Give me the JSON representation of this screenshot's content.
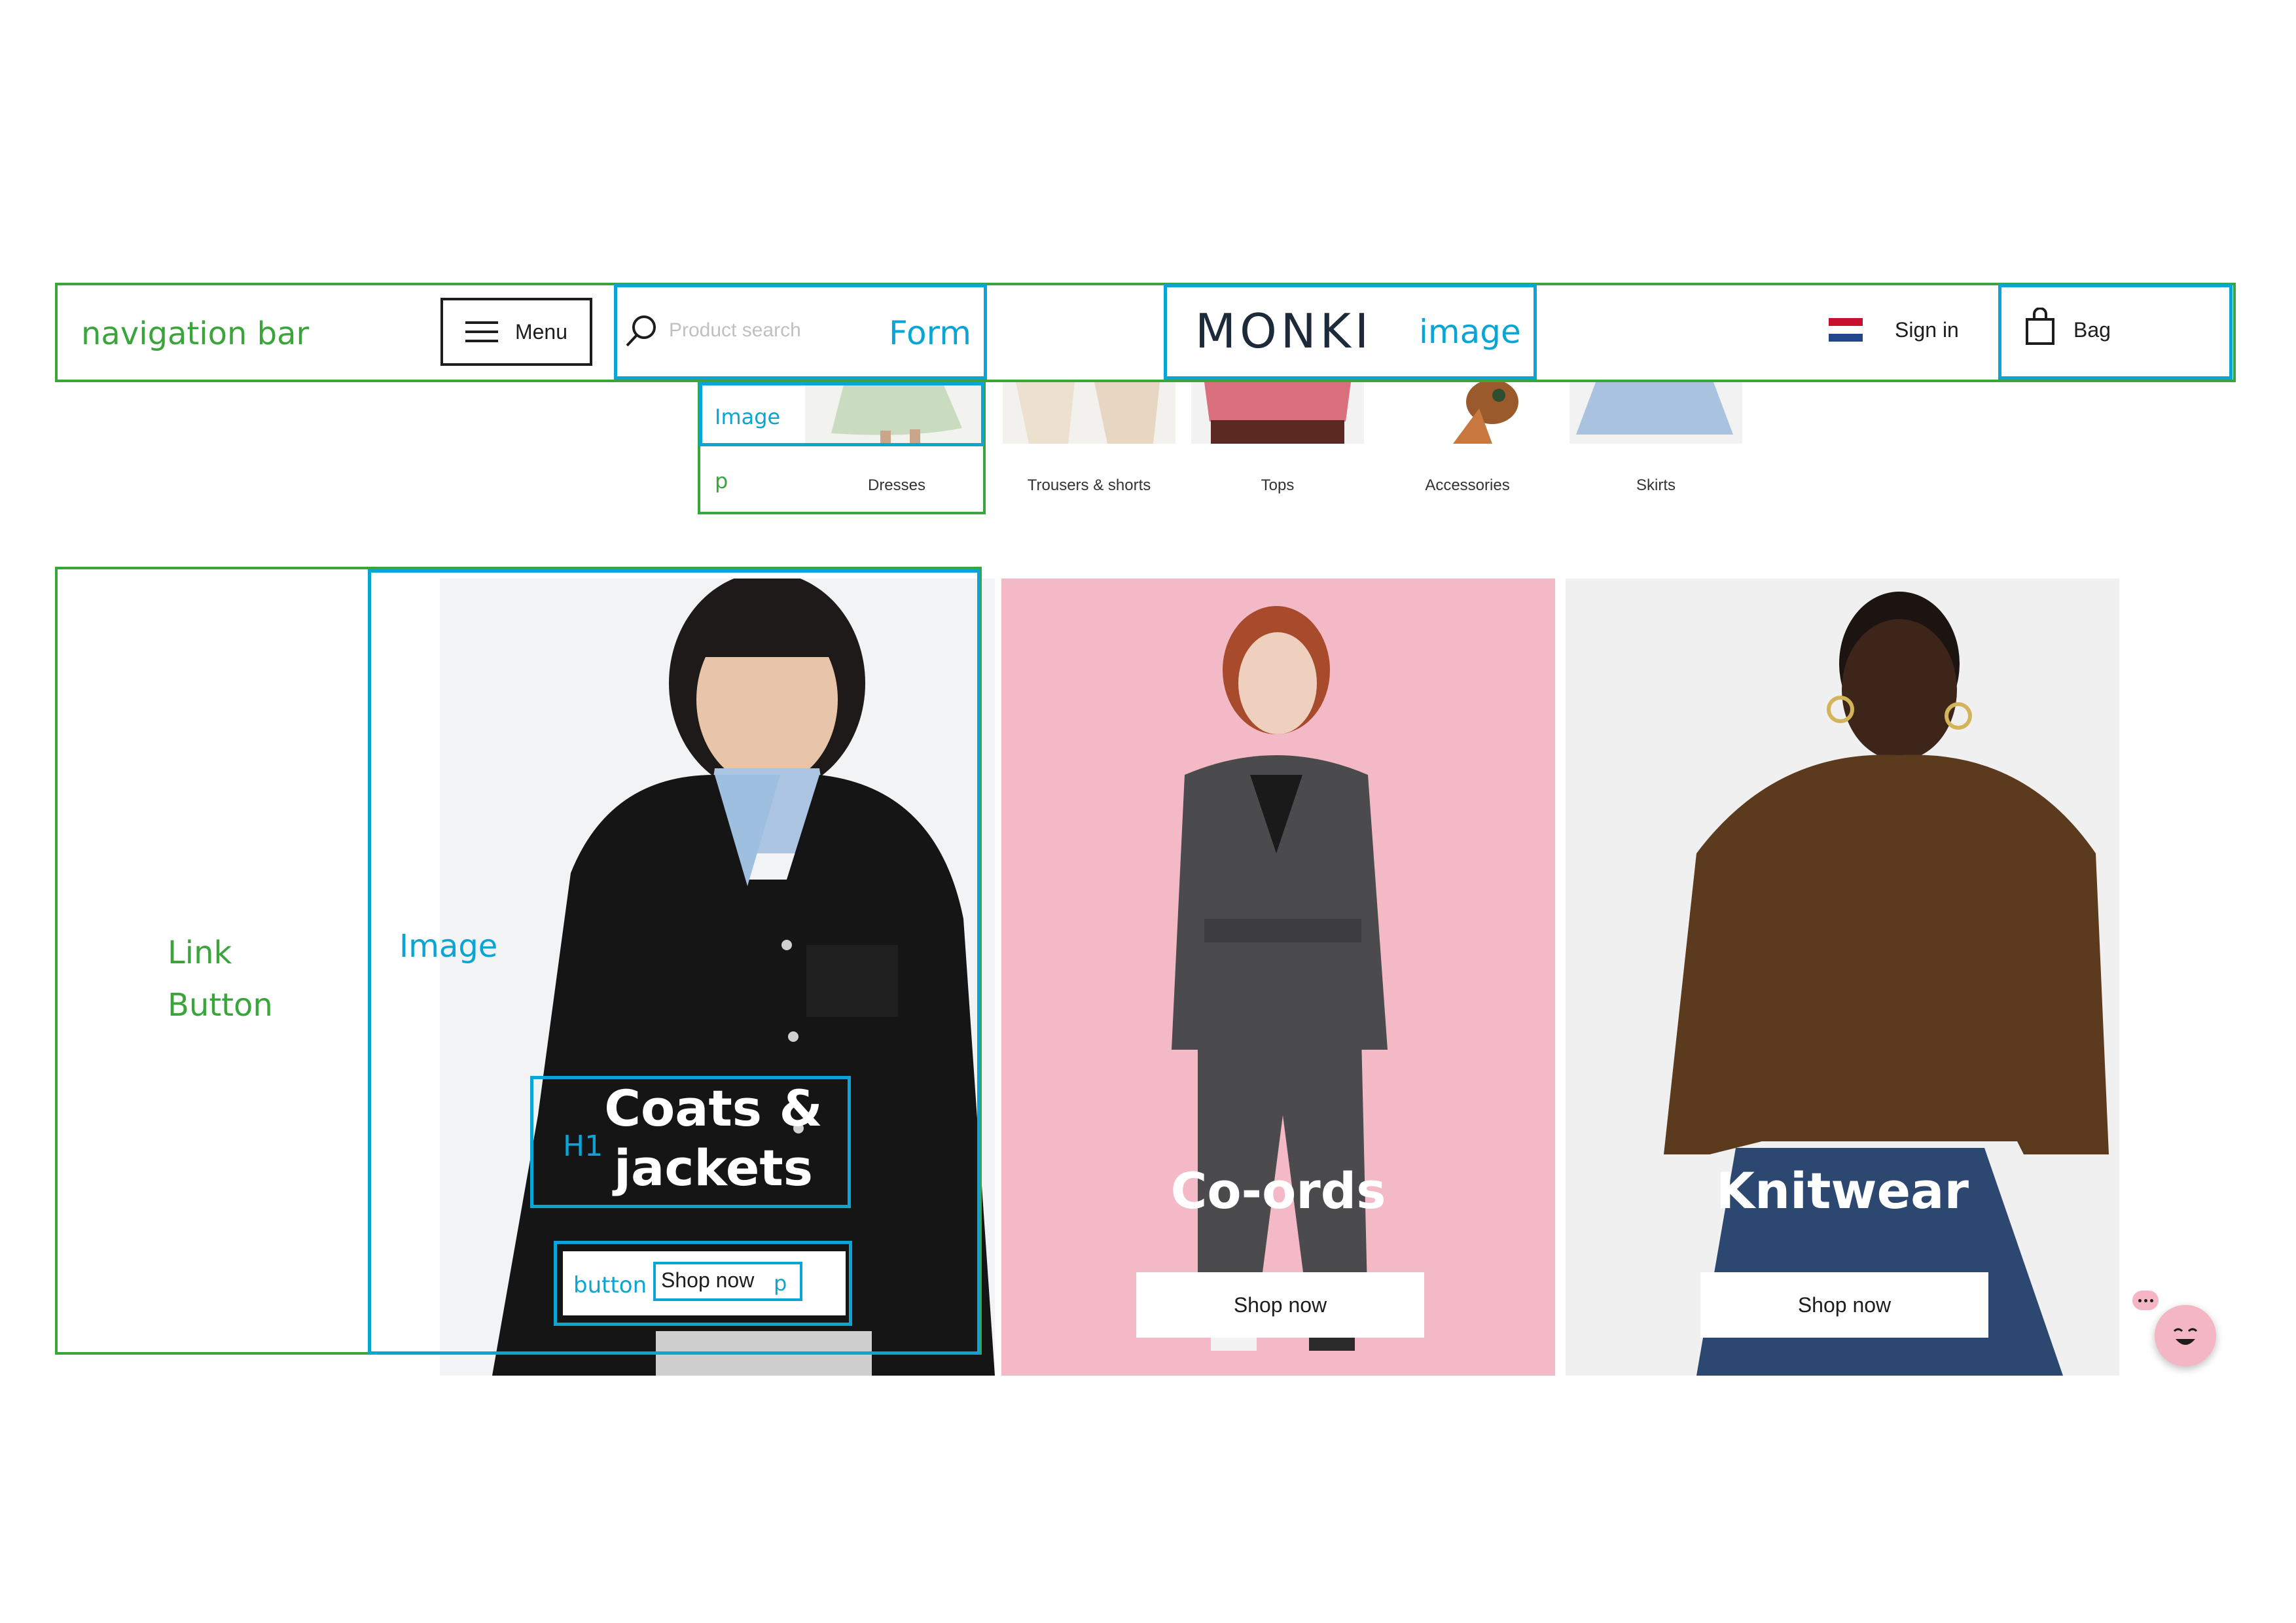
{
  "annotations": {
    "navigation_bar": "navigation bar",
    "form": "Form",
    "image": "image",
    "cat_image": "Image",
    "cat_p": "p",
    "link": "Link",
    "button_label": "Button",
    "hero_image": "Image",
    "h1": "H1",
    "button_small": "button",
    "p_small": "p"
  },
  "nav": {
    "menu_label": "Menu",
    "search_placeholder": "Product search",
    "logo": "MONKI",
    "sign_in": "Sign in",
    "bag": "Bag"
  },
  "categories": [
    {
      "label": "Dresses"
    },
    {
      "label": "Trousers & shorts"
    },
    {
      "label": "Tops"
    },
    {
      "label": "Accessories"
    },
    {
      "label": "Skirts"
    }
  ],
  "cards": [
    {
      "title_line1": "Coats &",
      "title_line2": "jackets",
      "cta": "Shop now"
    },
    {
      "title": "Co-ords",
      "cta": "Shop now"
    },
    {
      "title": "Knitwear",
      "cta": "Shop now"
    }
  ],
  "colors": {
    "annotation_green": "#3aa53a",
    "annotation_blue": "#0aa5d4",
    "card_pink": "#f4b9c7",
    "card_grey": "#f0f0f0"
  }
}
